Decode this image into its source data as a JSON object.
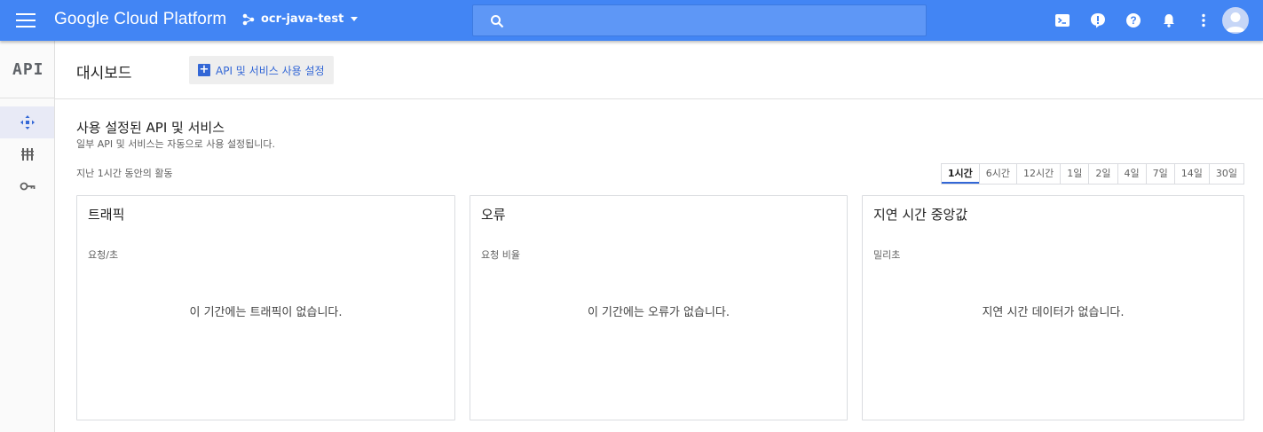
{
  "topbar": {
    "brand": "Google Cloud Platform",
    "project": "ocr-java-test",
    "search_placeholder": "",
    "icons": [
      "cloud-shell-icon",
      "feedback-icon",
      "help-icon",
      "notifications-icon",
      "more-vert-icon",
      "account-avatar"
    ]
  },
  "sidebar": {
    "logo": "API",
    "items": [
      {
        "icon": "dashboard-icon",
        "active": true
      },
      {
        "icon": "library-icon",
        "active": false
      },
      {
        "icon": "credentials-icon",
        "active": false
      }
    ]
  },
  "header": {
    "title": "대시보드",
    "enable_button": "API 및 서비스 사용 설정"
  },
  "section": {
    "title": "사용 설정된 API 및 서비스",
    "subtitle": "일부 API 및 서비스는 자동으로 사용 설정됩니다.",
    "period_label": "지난 1시간 동안의 활동",
    "ranges": [
      "1시간",
      "6시간",
      "12시간",
      "1일",
      "2일",
      "4일",
      "7일",
      "14일",
      "30일"
    ],
    "active_range": "1시간"
  },
  "cards": [
    {
      "title": "트래픽",
      "unit": "요청/초",
      "empty": "이 기간에는 트래픽이 없습니다."
    },
    {
      "title": "오류",
      "unit": "요청 비율",
      "empty": "이 기간에는 오류가 없습니다."
    },
    {
      "title": "지연 시간 중앙값",
      "unit": "밀리초",
      "empty": "지연 시간 데이터가 없습니다."
    }
  ],
  "colors": {
    "topbar": "#4285f4",
    "accent": "#3367d6"
  }
}
